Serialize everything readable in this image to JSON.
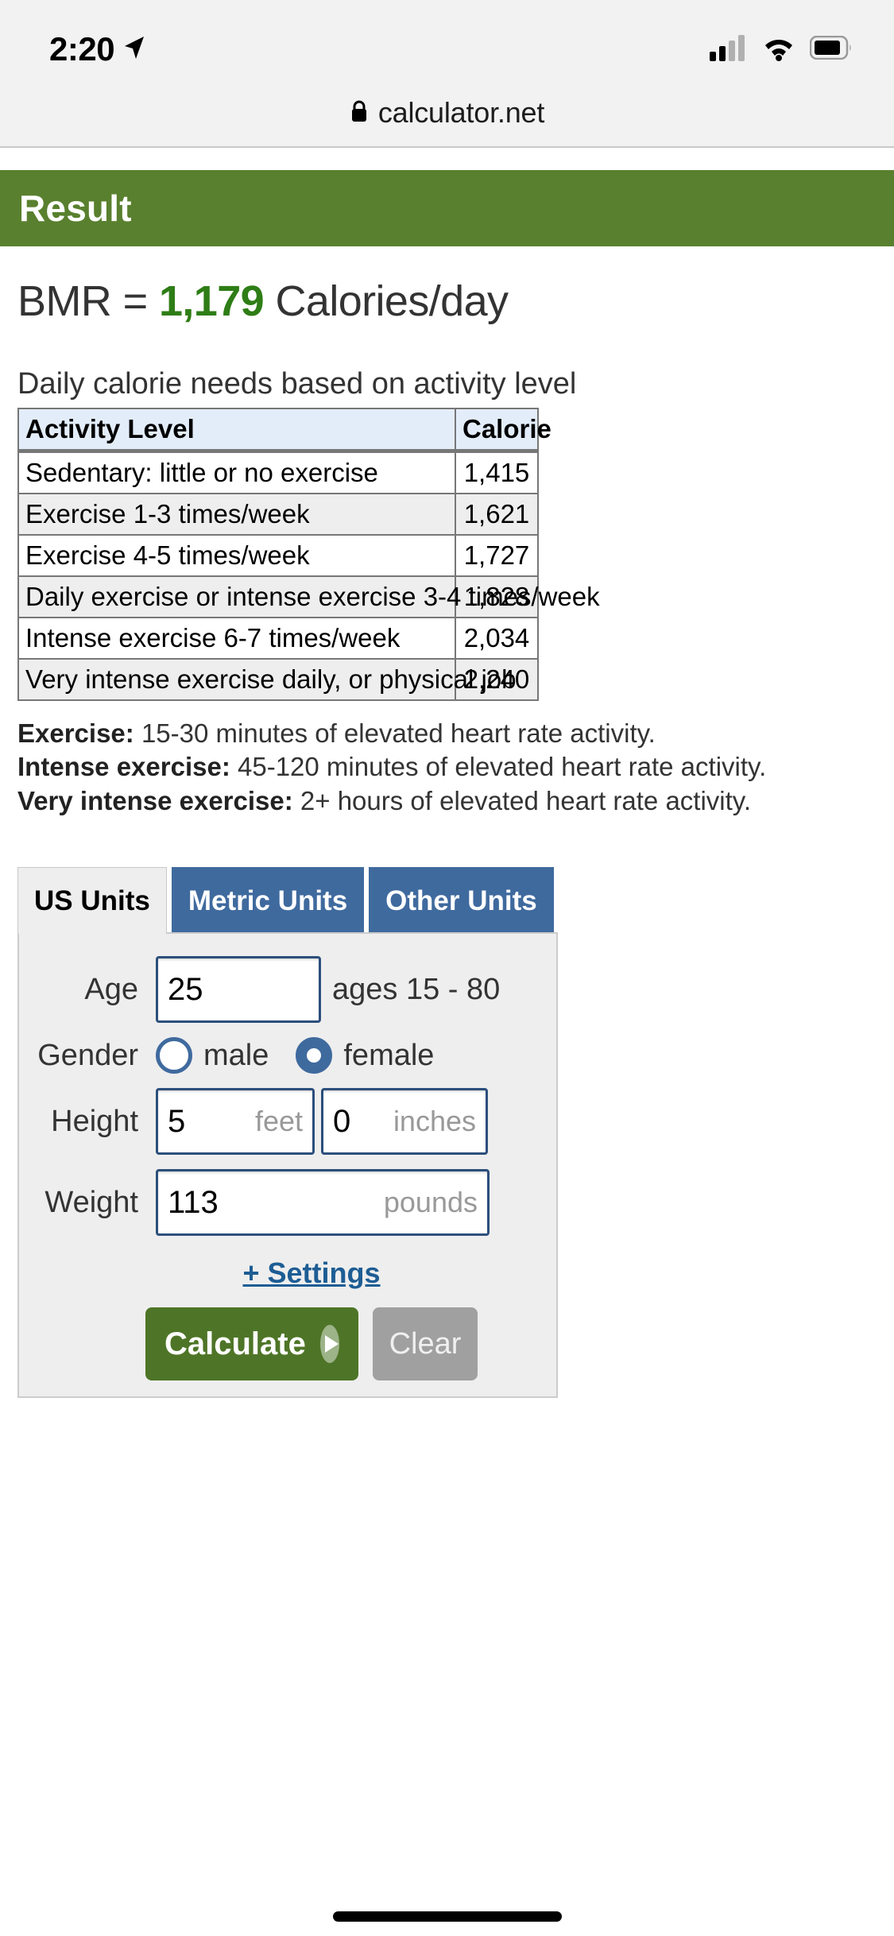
{
  "status_bar": {
    "time": "2:20",
    "location_icon": "location-arrow-icon",
    "cellular_icon": "cellular-signal-icon",
    "wifi_icon": "wifi-icon",
    "battery_icon": "battery-icon"
  },
  "browser": {
    "lock_icon": "lock-icon",
    "url": "calculator.net"
  },
  "result": {
    "header": "Result",
    "bmr_prefix": "BMR = ",
    "bmr_value": "1,179",
    "bmr_suffix": " Calories/day",
    "bmr_value_color": "#2e7d16",
    "header_bg": "#59802e",
    "subtitle": "Daily calorie needs based on activity level"
  },
  "table": {
    "headers": [
      "Activity Level",
      "Calorie"
    ],
    "header_bg": "#e3edfa",
    "rows": [
      {
        "level": "Sedentary: little or no exercise",
        "calorie": "1,415"
      },
      {
        "level": "Exercise 1-3 times/week",
        "calorie": "1,621"
      },
      {
        "level": "Exercise 4-5 times/week",
        "calorie": "1,727"
      },
      {
        "level": "Daily exercise or intense exercise 3-4 times/week",
        "calorie": "1,828"
      },
      {
        "level": "Intense exercise 6-7 times/week",
        "calorie": "2,034"
      },
      {
        "level": "Very intense exercise daily, or physical job",
        "calorie": "2,240"
      }
    ]
  },
  "notes": [
    {
      "term": "Exercise:",
      "text": " 15-30 minutes of elevated heart rate activity."
    },
    {
      "term": "Intense exercise:",
      "text": " 45-120 minutes of elevated heart rate activity."
    },
    {
      "term": "Very intense exercise:",
      "text": " 2+ hours of elevated heart rate activity."
    }
  ],
  "calculator": {
    "tabs": [
      {
        "label": "US Units",
        "active": true
      },
      {
        "label": "Metric Units",
        "active": false
      },
      {
        "label": "Other Units",
        "active": false
      }
    ],
    "tab_active_bg": "#eeeeee",
    "tab_inactive_bg": "#3f6a9e",
    "fields": {
      "age": {
        "label": "Age",
        "value": "25",
        "hint": "ages 15 - 80"
      },
      "gender": {
        "label": "Gender",
        "options": [
          {
            "label": "male",
            "checked": false
          },
          {
            "label": "female",
            "checked": true
          }
        ]
      },
      "height": {
        "label": "Height",
        "feet_value": "5",
        "feet_unit": "feet",
        "inches_value": "0",
        "inches_unit": "inches"
      },
      "weight": {
        "label": "Weight",
        "value": "113",
        "unit": "pounds"
      }
    },
    "settings_link": "+ Settings",
    "calculate_button": "Calculate",
    "clear_button": "Clear",
    "calculate_bg": "#4e7527",
    "clear_bg": "#a0a0a0"
  }
}
